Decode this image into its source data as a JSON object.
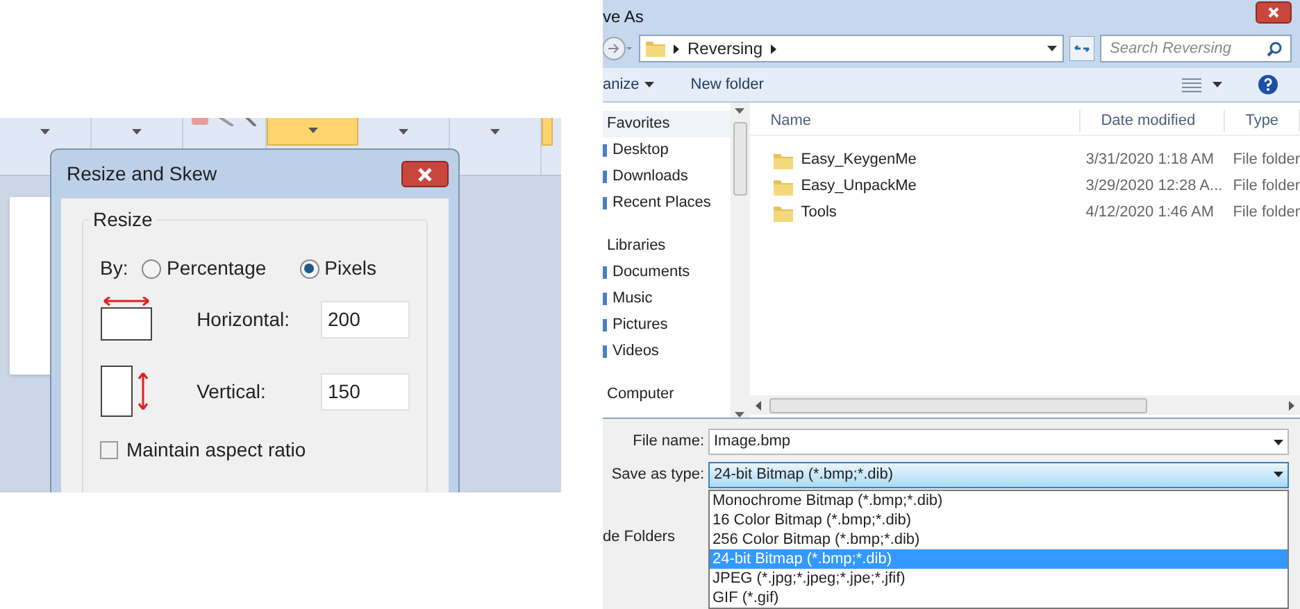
{
  "paint": {
    "ribbon_buttons": [
      {
        "selected": false
      },
      {
        "selected": false
      },
      {
        "selected": false,
        "kind": "tools"
      },
      {
        "selected": true
      },
      {
        "selected": false
      },
      {
        "selected": false
      },
      {
        "selected": true,
        "kind": "edge"
      }
    ],
    "dialog": {
      "title": "Resize and Skew",
      "group": "Resize",
      "by_label": "By:",
      "radios": [
        {
          "label": "Percentage",
          "selected": false
        },
        {
          "label": "Pixels",
          "selected": true
        }
      ],
      "fields": [
        {
          "kind": "horizontal",
          "label": "Horizontal:",
          "value": "200"
        },
        {
          "kind": "vertical",
          "label": "Vertical:",
          "value": "150"
        }
      ],
      "checkbox": {
        "label": "Maintain aspect ratio",
        "checked": false
      }
    }
  },
  "save_dialog": {
    "title": "ve As",
    "address": [
      "Reversing"
    ],
    "search": {
      "placeholder": "Search Reversing"
    },
    "toolbar": [
      {
        "label": "anize",
        "kind": "menu"
      },
      {
        "label": "New folder",
        "kind": "button"
      }
    ],
    "nav": [
      {
        "label": "Favorites",
        "children": [
          {
            "label": "Desktop"
          },
          {
            "label": "Downloads"
          },
          {
            "label": "Recent Places"
          }
        ]
      },
      {
        "label": "Libraries",
        "children": [
          {
            "label": "Documents"
          },
          {
            "label": "Music"
          },
          {
            "label": "Pictures"
          },
          {
            "label": "Videos"
          }
        ]
      },
      {
        "label": "Computer"
      }
    ],
    "columns": [
      "Name",
      "Date modified",
      "Type"
    ],
    "rows": [
      {
        "name": "Easy_KeygenMe",
        "date": "3/31/2020 1:18 AM",
        "type": "File folder"
      },
      {
        "name": "Easy_UnpackMe",
        "date": "3/29/2020 12:28 A...",
        "type": "File folder"
      },
      {
        "name": "Tools",
        "date": "4/12/2020 1:46 AM",
        "type": "File folder"
      }
    ],
    "file_name": {
      "label": "File name:",
      "value": "Image.bmp"
    },
    "save_type": {
      "label": "Save as type:",
      "value": "24-bit Bitmap (*.bmp;*.dib)"
    },
    "type_options": [
      {
        "label": "Monochrome Bitmap (*.bmp;*.dib)",
        "selected": false
      },
      {
        "label": "16 Color Bitmap (*.bmp;*.dib)",
        "selected": false
      },
      {
        "label": "256 Color Bitmap (*.bmp;*.dib)",
        "selected": false
      },
      {
        "label": "24-bit Bitmap (*.bmp;*.dib)",
        "selected": true
      },
      {
        "label": "JPEG (*.jpg;*.jpeg;*.jpe;*.jfif)",
        "selected": false
      },
      {
        "label": "GIF (*.gif)",
        "selected": false
      }
    ],
    "hide_folders": "de Folders"
  }
}
